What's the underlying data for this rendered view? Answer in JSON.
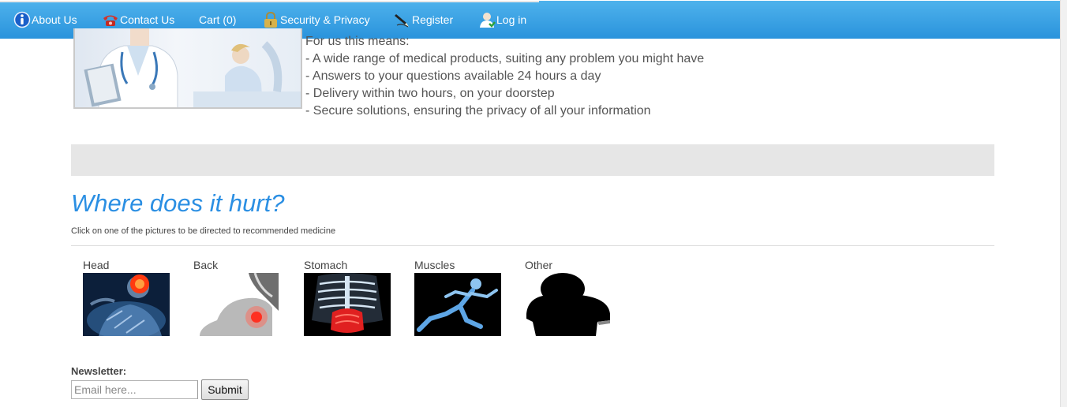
{
  "nav": {
    "items": [
      {
        "label": "About Us",
        "icon": "info-icon"
      },
      {
        "label": "Contact Us",
        "icon": "telephone-icon"
      },
      {
        "label": "Cart (0)",
        "icon": ""
      },
      {
        "label": "Security & Privacy",
        "icon": "padlock-icon"
      },
      {
        "label": "Register",
        "icon": "pen-icon"
      },
      {
        "label": "Log in",
        "icon": "user-icon"
      }
    ],
    "color": "#2a93dc"
  },
  "hero": {
    "image": "doctor-and-patient-photo",
    "lines": [
      "For us this means:",
      "- A wide range of medical products, suiting any problem you might have",
      "- Answers to your questions available 24 hours a day",
      "- Delivery within two hours, on your doorstep",
      "- Secure solutions, ensuring the privacy of all your information"
    ]
  },
  "hurt": {
    "title": "Where does it hurt?",
    "subtitle": "Click on one of the pictures to be directed to recommended medicine",
    "title_color": "#2b8fe3",
    "parts": [
      {
        "label": "Head",
        "image": "head-xray-image"
      },
      {
        "label": "Back",
        "image": "back-pain-image"
      },
      {
        "label": "Stomach",
        "image": "stomach-xray-image"
      },
      {
        "label": "Muscles",
        "image": "runner-xray-image"
      },
      {
        "label": "Other",
        "image": "silhouette-image"
      }
    ]
  },
  "newsletter": {
    "label": "Newsletter:",
    "placeholder": "Email here...",
    "submit_label": "Submit"
  }
}
